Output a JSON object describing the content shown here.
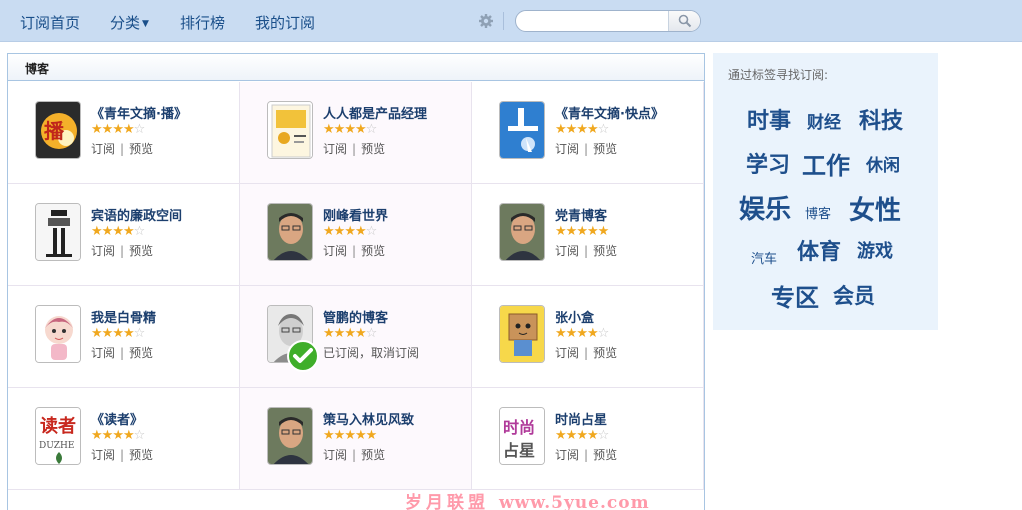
{
  "nav": {
    "home": "订阅首页",
    "category": "分类",
    "ranking": "排行榜",
    "my_subscriptions": "我的订阅"
  },
  "search": {
    "placeholder": ""
  },
  "panel": {
    "title": "博客"
  },
  "blogs": [
    {
      "name": "《青年文摘·播》",
      "stars": 4,
      "subscribe": "订阅",
      "preview": "预览",
      "avatar_icon": "broadcast-logo-icon"
    },
    {
      "name": "人人都是产品经理",
      "stars": 4,
      "subscribe": "订阅",
      "preview": "预览",
      "avatar_icon": "book-cover-icon"
    },
    {
      "name": "《青年文摘·快点》",
      "stars": 4,
      "subscribe": "订阅",
      "preview": "预览",
      "avatar_icon": "dot-character-logo-icon"
    },
    {
      "name": "宾语的廉政空间",
      "stars": 4,
      "subscribe": "订阅",
      "preview": "预览",
      "avatar_icon": "abstract-figure-icon"
    },
    {
      "name": "刚峰看世界",
      "stars": 4,
      "subscribe": "订阅",
      "preview": "预览",
      "avatar_icon": "man-photo-icon"
    },
    {
      "name": "党青博客",
      "stars": 5,
      "subscribe": "订阅",
      "preview": "预览",
      "avatar_icon": "man-photo-icon"
    },
    {
      "name": "我是白骨精",
      "stars": 4,
      "subscribe": "订阅",
      "preview": "预览",
      "avatar_icon": "cartoon-girl-icon"
    },
    {
      "name": "管鹏的博客",
      "stars": 4,
      "subscribe": "已订阅，",
      "preview": "取消订阅",
      "subscribed": true,
      "avatar_icon": "man-sketch-icon"
    },
    {
      "name": "张小盒",
      "stars": 4,
      "subscribe": "订阅",
      "preview": "预览",
      "avatar_icon": "box-character-icon"
    },
    {
      "name": "《读者》",
      "stars": 4,
      "subscribe": "订阅",
      "preview": "预览",
      "avatar_icon": "duzhe-logo-icon",
      "logo_text": "读者"
    },
    {
      "name": "策马入林见风致",
      "stars": 5,
      "subscribe": "订阅",
      "preview": "预览",
      "avatar_icon": "man-photo-icon"
    },
    {
      "name": "时尚占星",
      "stars": 4,
      "subscribe": "订阅",
      "preview": "预览",
      "avatar_icon": "astrology-logo-icon",
      "logo_text": "时尚占星"
    }
  ],
  "tag_cloud": {
    "title": "通过标签寻找订阅:",
    "tags": [
      "时事",
      "财经",
      "科技",
      "学习",
      "工作",
      "休闲",
      "娱乐",
      "博客",
      "女性",
      "汽车",
      "体育",
      "游戏",
      "专区",
      "会员"
    ]
  },
  "watermark": {
    "text": "岁月联盟",
    "url": "www.5yue.com"
  },
  "colors": {
    "topbar": "#c9dcf2",
    "link_blue": "#1a4f8a",
    "star_on": "#f0a81f",
    "star_off": "#c8c8c8",
    "tag_bg": "#eaf3fc",
    "check_green": "#3fae2a"
  }
}
